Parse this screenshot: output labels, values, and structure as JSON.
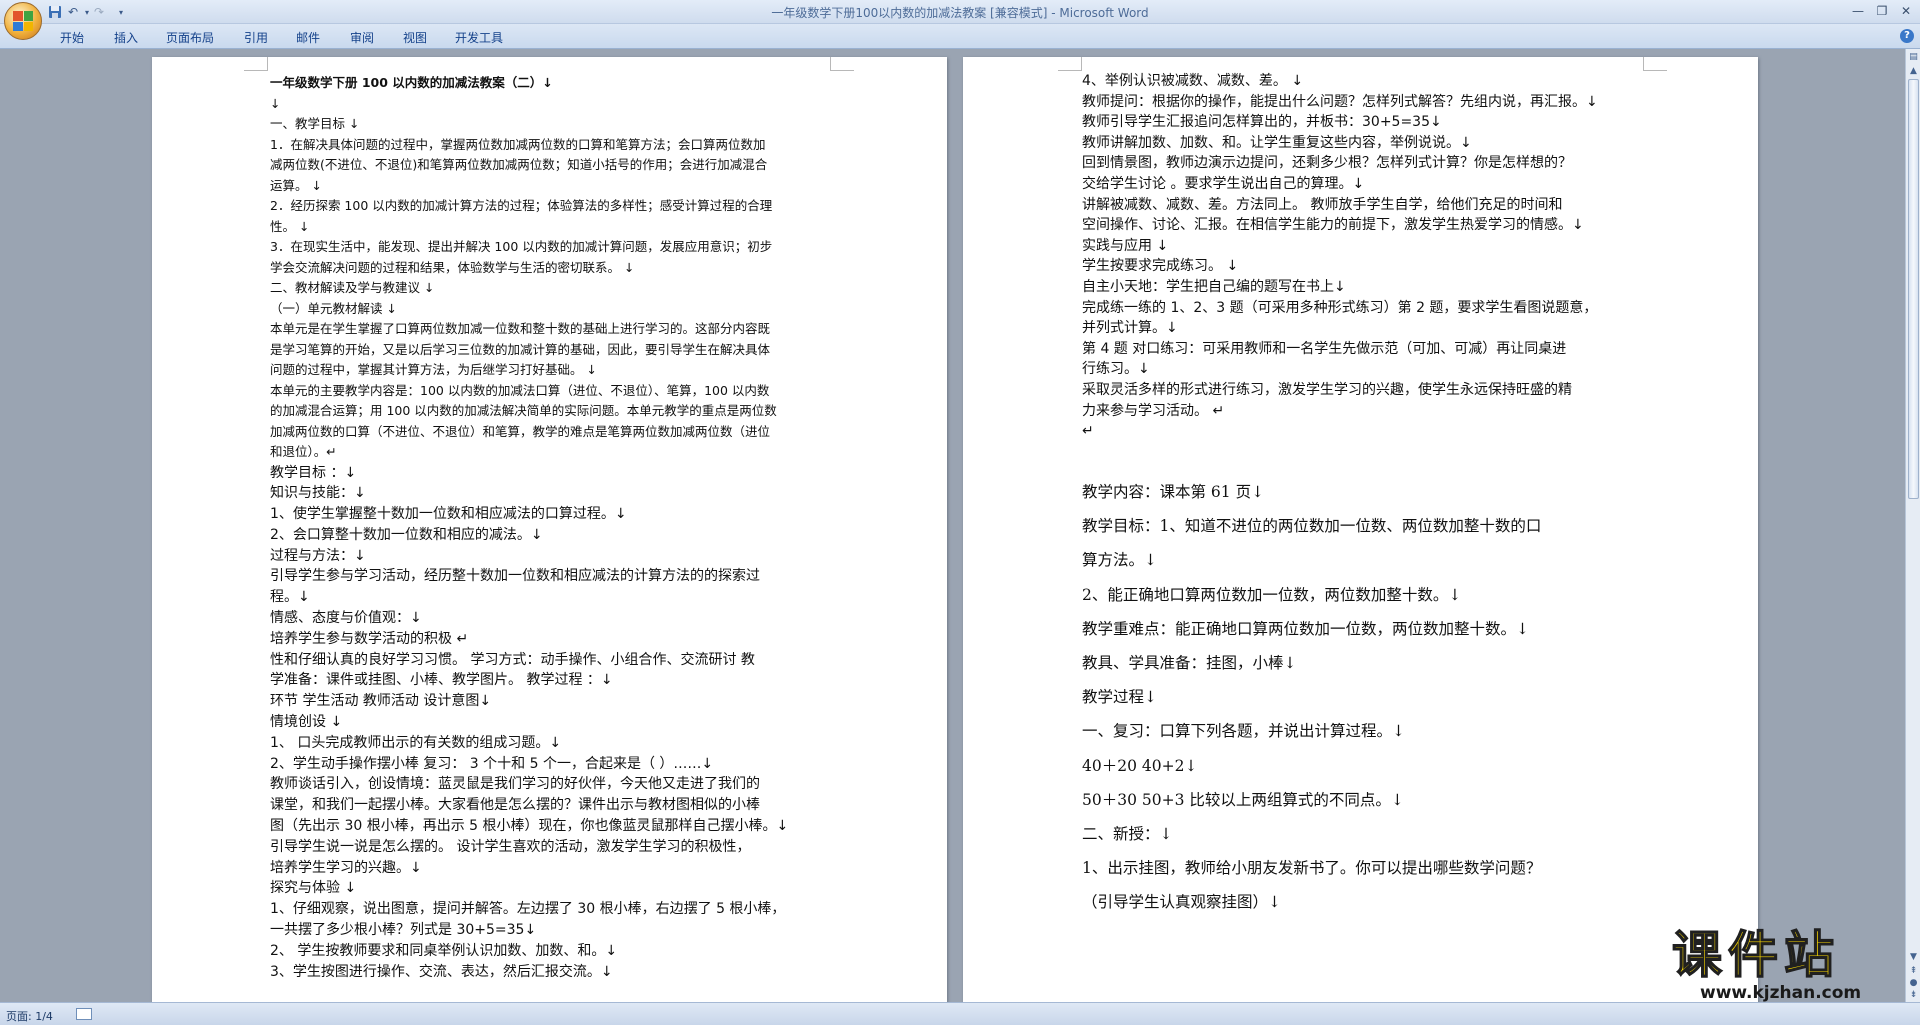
{
  "window": {
    "title": "一年级数学下册100以内数的加减法教案 [兼容模式] - ",
    "app_name": "Microsoft Word"
  },
  "ribbon": {
    "tabs": [
      "开始",
      "插入",
      "页面布局",
      "引用",
      "邮件",
      "审阅",
      "视图",
      "开发工具"
    ]
  },
  "page1": {
    "lines_small": [
      "一年级数学下册 100 以内数的加减法教案（二）↓",
      "↓",
      "一、教学目标 ↓",
      "1．在解决具体问题的过程中，掌握两位数加减两位数的口算和笔算方法；会口算两位数加",
      "减两位数(不进位、不退位)和笔算两位数加减两位数；知道小括号的作用；会进行加减混合",
      "运算。 ↓",
      "2．经历探索 100 以内数的加减计算方法的过程；体验算法的多样性；感受计算过程的合理",
      "性。 ↓",
      "3．在现实生活中，能发现、提出并解决 100 以内数的加减计算问题，发展应用意识；初步",
      "学会交流解决问题的过程和结果，体验数学与生活的密切联系。 ↓",
      "二、教材解读及学与教建议 ↓",
      "（一）单元教材解读 ↓",
      "本单元是在学生掌握了口算两位数加减一位数和整十数的基础上进行学习的。这部分内容既",
      "是学习笔算的开始，又是以后学习三位数的加减计算的基础，因此，要引导学生在解决具体",
      "问题的过程中，掌握其计算方法，为后继学习打好基础。 ↓",
      "本单元的主要教学内容是：100 以内数的加减法口算（进位、不退位）、笔算，100 以内数",
      "的加减混合运算；用 100 以内数的加减法解决简单的实际问题。本单元教学的重点是两位数",
      "加减两位数的口算（不进位、不退位）和笔算，教学的难点是笔算两位数加减两位数（进位",
      "和退位）。↵"
    ],
    "lines_medium": [
      "   教学目标   ：↓",
      "知识与技能：↓",
      "1、使学生掌握整十数加一位数和相应减法的口算过程。↓",
      "2、会口算整十数加一位数和相应的减法。↓",
      "过程与方法：↓",
      "引导学生参与学习活动，经历整十数加一位数和相应减法的计算方法的的探索过",
      "程。↓",
      "情感、态度与价值观：↓",
      "培养学生参与数学活动的积极 ↵",
      "  性和仔细认真的良好学习习惯。 学习方式：动手操作、小组合作、交流研讨  教",
      "  学准备：课件或挂图、小棒、教学图片。   教学过程    ：↓",
      "环节    学生活动    教师活动    设计意图↓",
      "情境创设    ↓",
      "1、    口头完成教师出示的有关数的组成习题。↓",
      "2、学生动手操作摆小棒    复习：  3 个十和 5 个一，合起来是（      ）……↓",
      "教师谈话引入，创设情境：蓝灵鼠是我们学习的好伙伴，今天他又走进了我们的",
      "课堂，和我们一起摆小棒。大家看他是怎么摆的？课件出示与教材图相似的小棒",
      "图（先出示 30 根小棒，再出示 5 根小棒）现在，你也像蓝灵鼠那样自己摆小棒。↓",
      "引导学生说一说是怎么摆的。    设计学生喜欢的活动，激发学生学习的积极性，",
      "培养学生学习的兴趣。↓",
      "探究与体验    ↓",
      "1、仔细观察，说出图意，提问并解答。左边摆了 30 根小棒，右边摆了 5 根小棒，",
      "一共摆了多少根小棒？列式是 30+5=35↓",
      "2、    学生按教师要求和同桌举例认识加数、加数、和。↓",
      "3、学生按图进行操作、交流、表达，然后汇报交流。↓"
    ]
  },
  "page2": {
    "lines_top": [
      "4、举例认识被减数、减数、差。    ↓",
      "教师提问：根据你的操作，能提出什么问题？怎样列式解答？先组内说，再汇报。↓",
      "教师引导学生汇报追问怎样算出的，并板书：30+5=35↓",
      "教师讲解加数、加数、和。让学生重复这些内容，举例说说。↓",
      "回到情景图，教师边演示边提问，还剩多少根？怎样列式计算？你是怎样想的？",
      "交给学生讨论 。要求学生说出自己的算理。↓",
      "讲解被减数、减数、差。方法同上。    教师放手学生自学，给他们充足的时间和",
      "空间操作、讨论、汇报。在相信学生能力的前提下，激发学生热爱学习的情感。↓",
      "实践与应用    ↓",
      "学生按要求完成练习。    ↓",
      "自主小天地：学生把自己编的题写在书上↓",
      "完成练一练的 1、2、3 题（可采用多种形式练习）第 2 题，要求学生看图说题意，",
      "并列式计算。↓",
      "第 4 题 对口练习：可采用教师和一名学生先做示范（可加、可减）再让同桌进",
      "行练习。↓",
      "采取灵活多样的形式进行练习，激发学生学习的兴趣，使学生永远保持旺盛的精",
      "力来参与学习活动。 ↵",
      "",
      "↵"
    ],
    "lines_bottom": [
      "教学内容：课本第 61 页↓",
      "教学目标：1、知道不进位的两位数加一位数、两位数加整十数的口",
      "算方法。↓",
      "          2、能正确地口算两位数加一位数，两位数加整十数。↓",
      "教学重难点：能正确地口算两位数加一位数，两位数加整十数。↓",
      "教具、学具准备：挂图，小棒↓",
      "教学过程↓",
      "一、复习：口算下列各题，并说出计算过程。↓",
      "40＋20       40+2↓",
      "50＋30       50+3        比较以上两组算式的不同点。↓",
      "二、新授：↓",
      "1、出示挂图，教师给小朋友发新书了。你可以提出哪些数学问题？",
      "（引导学生认真观察挂图）↓"
    ]
  },
  "status": {
    "page_indicator": "页面: 1/4"
  },
  "watermark": {
    "main": "课件站",
    "url": "www.kjzhan.com"
  },
  "colors": {
    "ribbon_text": "#15428b",
    "workspace": "#9aa4b2",
    "watermark_yellow": "#f6d400"
  }
}
